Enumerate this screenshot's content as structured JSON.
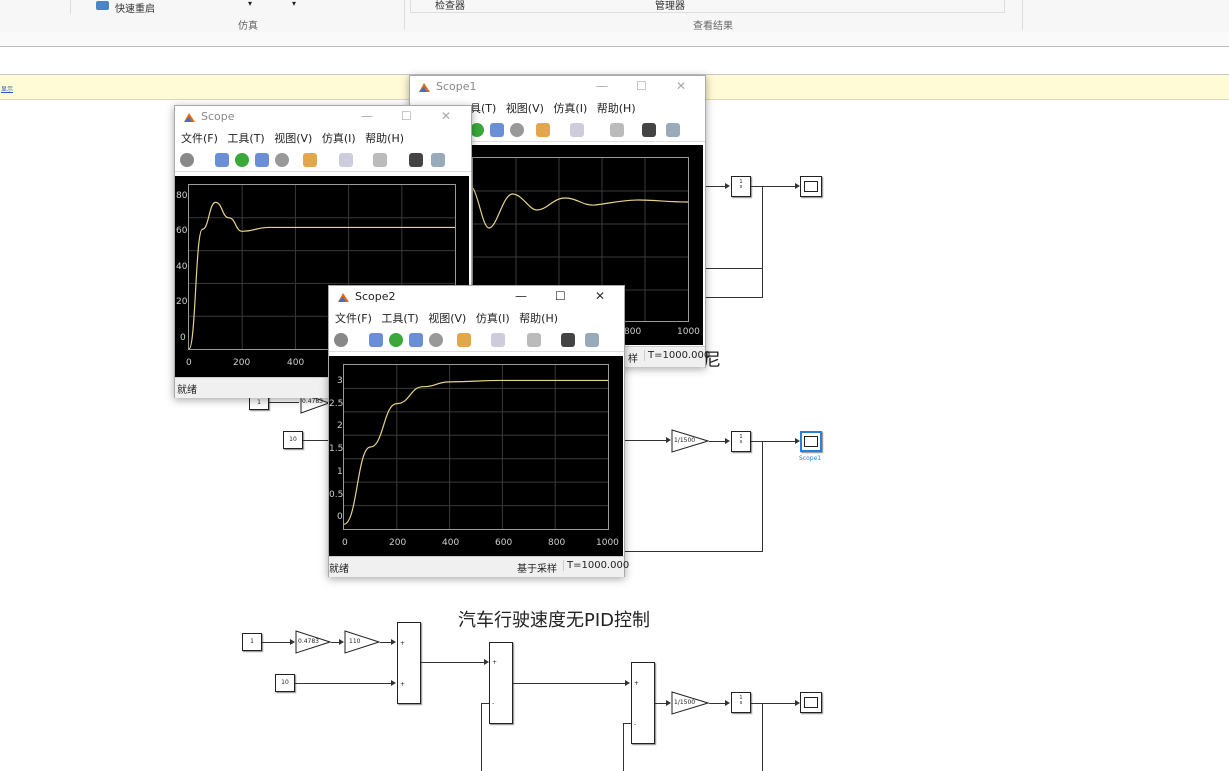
{
  "ribbon": {
    "quick_restart": "快速重启",
    "inspector": "检查器",
    "manager": "管理器",
    "group_sim": "仿真",
    "group_results": "查看结果"
  },
  "infobar": {
    "link": "显示"
  },
  "scope1": {
    "title": "Scope1",
    "menu": [
      "具(T)",
      "视图(V)",
      "仿真(I)",
      "帮助(H)"
    ],
    "xticks": [
      "800",
      "1000"
    ],
    "status_mode": "样",
    "status_time": "T=1000.000"
  },
  "scope": {
    "title": "Scope",
    "menu": [
      "文件(F)",
      "工具(T)",
      "视图(V)",
      "仿真(I)",
      "帮助(H)"
    ],
    "yticks": [
      "80",
      "60",
      "40",
      "20",
      "0"
    ],
    "xticks": [
      "0",
      "200",
      "400"
    ],
    "status": "就绪"
  },
  "scope2": {
    "title": "Scope2",
    "menu": [
      "文件(F)",
      "工具(T)",
      "视图(V)",
      "仿真(I)",
      "帮助(H)"
    ],
    "yticks": [
      "3",
      "2.5",
      "2",
      "1.5",
      "1",
      "0.5",
      "0"
    ],
    "xticks": [
      "0",
      "200",
      "400",
      "600",
      "800",
      "1000"
    ],
    "status": "就绪",
    "status_mode": "基于采样",
    "status_time": "T=1000.000"
  },
  "model": {
    "heading_partial": "尼",
    "heading_bottom": "汽车行驶速度无PID控制",
    "const_1": "1",
    "const_10": "10",
    "gain_0478": "0.4783",
    "gain_110": "110",
    "gain_inv1500": "1/1500",
    "integrator_num": "1",
    "integrator_den": "s",
    "scope1_label": "Scope1",
    "sum_plus": "+",
    "sum_minus": "-"
  },
  "chart_data": [
    {
      "type": "line",
      "title": "",
      "series": [
        {
          "x": [
            0,
            50,
            100,
            150,
            200,
            300,
            400,
            600,
            800,
            1000
          ],
          "values": [
            0,
            62,
            76,
            68,
            61,
            63,
            63,
            63,
            63,
            63
          ]
        }
      ],
      "xlim": [
        0,
        1000
      ],
      "ylim": [
        0,
        85
      ]
    },
    {
      "type": "line",
      "title": "",
      "series": [
        {
          "x": [
            0,
            100,
            200,
            300,
            400,
            600,
            800,
            1000
          ],
          "values": [
            0,
            1.6,
            2.5,
            2.85,
            2.95,
            2.98,
            2.98,
            2.98
          ]
        }
      ],
      "xlim": [
        0,
        1000
      ],
      "ylim": [
        -0.1,
        3.3
      ]
    }
  ]
}
